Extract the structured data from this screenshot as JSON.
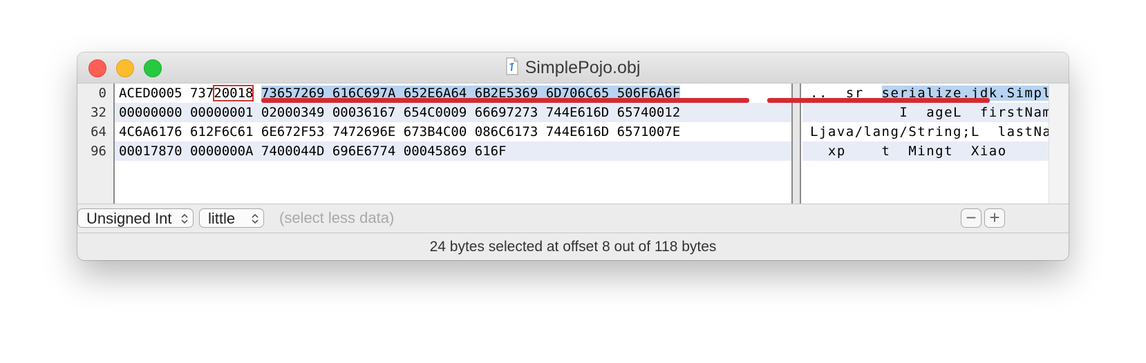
{
  "window": {
    "title": "SimplePojo.obj",
    "colors": {
      "close": "#fd5f57",
      "minimize": "#febb2e",
      "zoom": "#28c840"
    }
  },
  "gutter": {
    "offsets": [
      "0",
      "32",
      "64",
      "96"
    ]
  },
  "hex": {
    "row0": {
      "before": "ACED0005 737",
      "boxed": "20018",
      "gap": " ",
      "selected": "73657269 616C697A 652E6A64 6B2E5369 6D706C65 506F6A6F"
    },
    "row1": "00000000 00000001 02000349 00036167 654C0009 66697273 744E616D 65740012",
    "row2": "4C6A6176 612F6C61 6E672F53 7472696E 673B4C00 086C6173 744E616D 6571007E",
    "row3": "00017870 0000000A 7400044D 696E6774 00045869 616F"
  },
  "ascii": {
    "row0": {
      "before": "..  sr  ",
      "selected": "serialize.jdk.SimplePojo"
    },
    "row1": "          I  ageL  firstNamet",
    "row2": "Ljava/lang/String;L  lastNameq ~",
    "row3": "  xp    t  Mingt  Xiao"
  },
  "controls": {
    "type_select": "Unsigned Int",
    "endian_select": "little",
    "hint": "(select less data)",
    "minus": "−",
    "plus": "+"
  },
  "status": "24 bytes selected at offset 8 out of 118 bytes",
  "annotation_color": "#d42a30",
  "selection_color": "#b7d3f1"
}
